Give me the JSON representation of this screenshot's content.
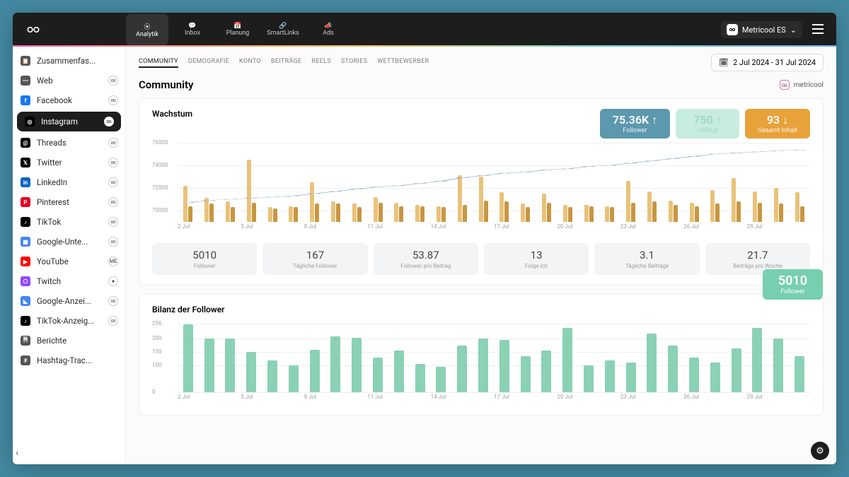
{
  "topnav": {
    "items": [
      {
        "id": "analytics",
        "label": "Analytik",
        "active": true
      },
      {
        "id": "inbox",
        "label": "Inbox",
        "active": false
      },
      {
        "id": "planning",
        "label": "Planung",
        "active": false
      },
      {
        "id": "smartlinks",
        "label": "SmartLinks",
        "active": false
      },
      {
        "id": "ads",
        "label": "Ads",
        "active": false
      }
    ],
    "workspace": "Metricool ES"
  },
  "sidebar": {
    "items": [
      {
        "id": "summary",
        "label": "Zusammenfas...",
        "icon": "clipboard",
        "badge": ""
      },
      {
        "id": "web",
        "label": "Web",
        "icon": "rss",
        "badge": "∞"
      },
      {
        "id": "facebook",
        "label": "Facebook",
        "icon": "fb",
        "badge": "∞"
      },
      {
        "id": "instagram",
        "label": "Instagram",
        "icon": "ig",
        "badge": "∞",
        "active": true
      },
      {
        "id": "threads",
        "label": "Threads",
        "icon": "th",
        "badge": "∞"
      },
      {
        "id": "twitter",
        "label": "Twitter",
        "icon": "x",
        "badge": "∞"
      },
      {
        "id": "linkedin",
        "label": "LinkedIn",
        "icon": "li",
        "badge": "∞"
      },
      {
        "id": "pinterest",
        "label": "Pinterest",
        "icon": "pi",
        "badge": "∞"
      },
      {
        "id": "tiktok",
        "label": "TikTok",
        "icon": "tt",
        "badge": "∞"
      },
      {
        "id": "google-biz",
        "label": "Google-Unte...",
        "icon": "gb",
        "badge": "∞"
      },
      {
        "id": "youtube",
        "label": "YouTube",
        "icon": "yt",
        "badge": "ME"
      },
      {
        "id": "twitch",
        "label": "Twitch",
        "icon": "tw",
        "badge": "●"
      },
      {
        "id": "google-ads",
        "label": "Google-Anzei...",
        "icon": "ga",
        "badge": "∞"
      },
      {
        "id": "tiktok-ads",
        "label": "TikTok-Anzeig...",
        "icon": "tta",
        "badge": "∞"
      },
      {
        "id": "reports",
        "label": "Berichte",
        "icon": "doc",
        "badge": ""
      },
      {
        "id": "hashtag",
        "label": "Hashtag-Trac...",
        "icon": "hash",
        "badge": ""
      }
    ]
  },
  "tabs": [
    {
      "id": "community",
      "label": "COMMUNITY",
      "active": true
    },
    {
      "id": "demographics",
      "label": "DEMOGRAFIE"
    },
    {
      "id": "account",
      "label": "KONTO"
    },
    {
      "id": "posts",
      "label": "BEITRÄGE"
    },
    {
      "id": "reels",
      "label": "REELS"
    },
    {
      "id": "stories",
      "label": "STORIES"
    },
    {
      "id": "competitors",
      "label": "WETTBEWERBER"
    }
  ],
  "date_range": "2 Jul 2024 - 31 Jul 2024",
  "page_title": "Community",
  "brand_account": "metricool",
  "growth": {
    "title": "Wachstum",
    "pills": [
      {
        "value": "75.36K",
        "arrow": "↑",
        "label": "Follower",
        "cls": "p-teal"
      },
      {
        "value": "750",
        "arrow": "↑",
        "label": "Gefolgt",
        "cls": "p-mint"
      },
      {
        "value": "93",
        "arrow": "↓",
        "label": "Gesamt Inhalt",
        "cls": "p-orange"
      }
    ],
    "stats": [
      {
        "value": "5010",
        "label": "Follower"
      },
      {
        "value": "167",
        "label": "Tägliche Follower"
      },
      {
        "value": "53.87",
        "label": "Follower pro Beitrag"
      },
      {
        "value": "13",
        "label": "Folge ich"
      },
      {
        "value": "3.1",
        "label": "Tägliche Beiträge"
      },
      {
        "value": "21.7",
        "label": "Beiträge pro Woche"
      }
    ]
  },
  "balance": {
    "title": "Bilanz der Follower",
    "pill": {
      "value": "5010",
      "label": "Follower"
    }
  },
  "chart_data": [
    {
      "id": "growth",
      "type": "bar+line",
      "yticks": [
        70000,
        72000,
        74000,
        76000
      ],
      "ylim": [
        69000,
        76000
      ],
      "xticks": [
        "2 Jul",
        "5 Jul",
        "8 Jul",
        "11 Jul",
        "14 Jul",
        "17 Jul",
        "20 Jul",
        "23 Jul",
        "26 Jul",
        "29 Jul"
      ],
      "categories": [
        "2 Jul",
        "3 Jul",
        "4 Jul",
        "5 Jul",
        "6 Jul",
        "7 Jul",
        "8 Jul",
        "9 Jul",
        "10 Jul",
        "11 Jul",
        "12 Jul",
        "13 Jul",
        "14 Jul",
        "15 Jul",
        "16 Jul",
        "17 Jul",
        "18 Jul",
        "19 Jul",
        "20 Jul",
        "21 Jul",
        "22 Jul",
        "23 Jul",
        "24 Jul",
        "25 Jul",
        "26 Jul",
        "27 Jul",
        "28 Jul",
        "29 Jul",
        "30 Jul",
        "31 Jul"
      ],
      "series": [
        {
          "name": "barA",
          "color": "#e9c27a",
          "values": [
            72200,
            71100,
            70800,
            74500,
            70300,
            70400,
            72500,
            70800,
            70600,
            71200,
            70700,
            70500,
            70400,
            73100,
            73000,
            71600,
            70600,
            71500,
            70500,
            70500,
            70400,
            72600,
            71700,
            70900,
            70700,
            71800,
            72900,
            71700,
            72000,
            71600
          ]
        },
        {
          "name": "barB",
          "color": "#c79640",
          "values": [
            70400,
            70600,
            70300,
            70700,
            70200,
            70300,
            70600,
            70600,
            70300,
            70700,
            70400,
            70400,
            70300,
            70500,
            70900,
            70800,
            70300,
            70700,
            70300,
            70400,
            70300,
            70700,
            70800,
            70500,
            70400,
            70600,
            70800,
            70700,
            70600,
            70400
          ]
        },
        {
          "name": "line_followers",
          "color": "#6a96b3",
          "values": [
            70700,
            70900,
            71000,
            71100,
            71200,
            71300,
            71500,
            71700,
            71900,
            72100,
            72200,
            72400,
            72600,
            72900,
            73100,
            73300,
            73400,
            73600,
            73700,
            73900,
            74000,
            74200,
            74400,
            74600,
            74800,
            75000,
            75100,
            75200,
            75300,
            75360
          ]
        }
      ]
    },
    {
      "id": "balance",
      "type": "bar",
      "yticks": [
        0,
        100,
        150,
        200,
        256
      ],
      "ylim": [
        0,
        270
      ],
      "xticks": [
        "2 Jul",
        "5 Jul",
        "8 Jul",
        "11 Jul",
        "14 Jul",
        "17 Jul",
        "20 Jul",
        "23 Jul",
        "26 Jul",
        "29 Jul"
      ],
      "categories": [
        "2 Jul",
        "3 Jul",
        "4 Jul",
        "5 Jul",
        "6 Jul",
        "7 Jul",
        "8 Jul",
        "9 Jul",
        "10 Jul",
        "11 Jul",
        "12 Jul",
        "13 Jul",
        "14 Jul",
        "15 Jul",
        "16 Jul",
        "17 Jul",
        "18 Jul",
        "19 Jul",
        "20 Jul",
        "21 Jul",
        "22 Jul",
        "23 Jul",
        "24 Jul",
        "25 Jul",
        "26 Jul",
        "27 Jul",
        "28 Jul",
        "29 Jul",
        "30 Jul",
        "31 Jul"
      ],
      "series": [
        {
          "name": "follower_balance",
          "color": "#8ad1b5",
          "values": [
            255,
            200,
            200,
            150,
            120,
            100,
            160,
            210,
            205,
            130,
            155,
            105,
            95,
            175,
            200,
            195,
            135,
            155,
            240,
            100,
            120,
            110,
            220,
            175,
            130,
            110,
            165,
            240,
            200,
            135
          ]
        }
      ]
    }
  ]
}
